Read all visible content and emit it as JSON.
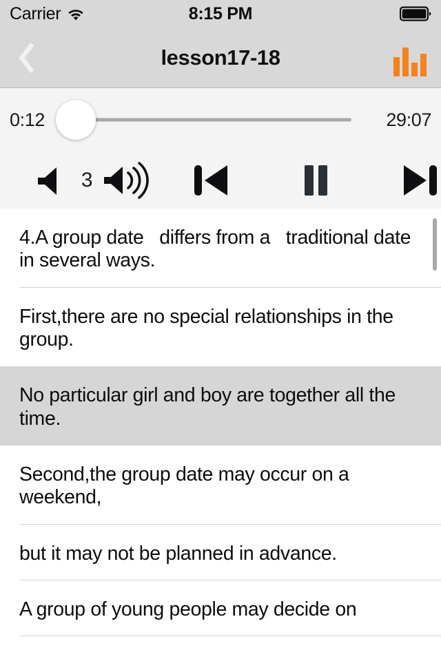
{
  "status_bar": {
    "carrier": "Carrier",
    "wifi_icon": "wifi-icon",
    "time": "8:15 PM",
    "battery_icon": "battery-full-icon"
  },
  "nav_bar": {
    "back_icon": "chevron-left-icon",
    "title": "lesson17-18",
    "equalizer_icon": "equalizer-icon",
    "accent_color": "#f5821f",
    "background_color": "#d8d8d8"
  },
  "player": {
    "current_time": "0:12",
    "total_time": "29:07",
    "progress_percent": 3,
    "background_color": "#f4f4f4",
    "controls": {
      "volume_down_icon": "volume-down-icon",
      "volume_level": "3",
      "volume_up_icon": "volume-up-icon",
      "previous_icon": "skip-previous-icon",
      "play_pause_icon": "pause-icon",
      "next_icon": "skip-next-icon"
    }
  },
  "transcript": {
    "highlight_color": "#d6d6d6",
    "rows": [
      {
        "text": "4.A group date   differs from a   traditional date   in several ways.",
        "active": false
      },
      {
        "text": "First,there are no special relationships in the group.",
        "active": false
      },
      {
        "text": "No particular girl and boy are together all the time.",
        "active": true
      },
      {
        "text": "Second,the group date may occur on a weekend,",
        "active": false
      },
      {
        "text": "but it may not be planned in advance.",
        "active": false
      },
      {
        "text": "A group of young people may decide on",
        "active": false
      }
    ]
  }
}
